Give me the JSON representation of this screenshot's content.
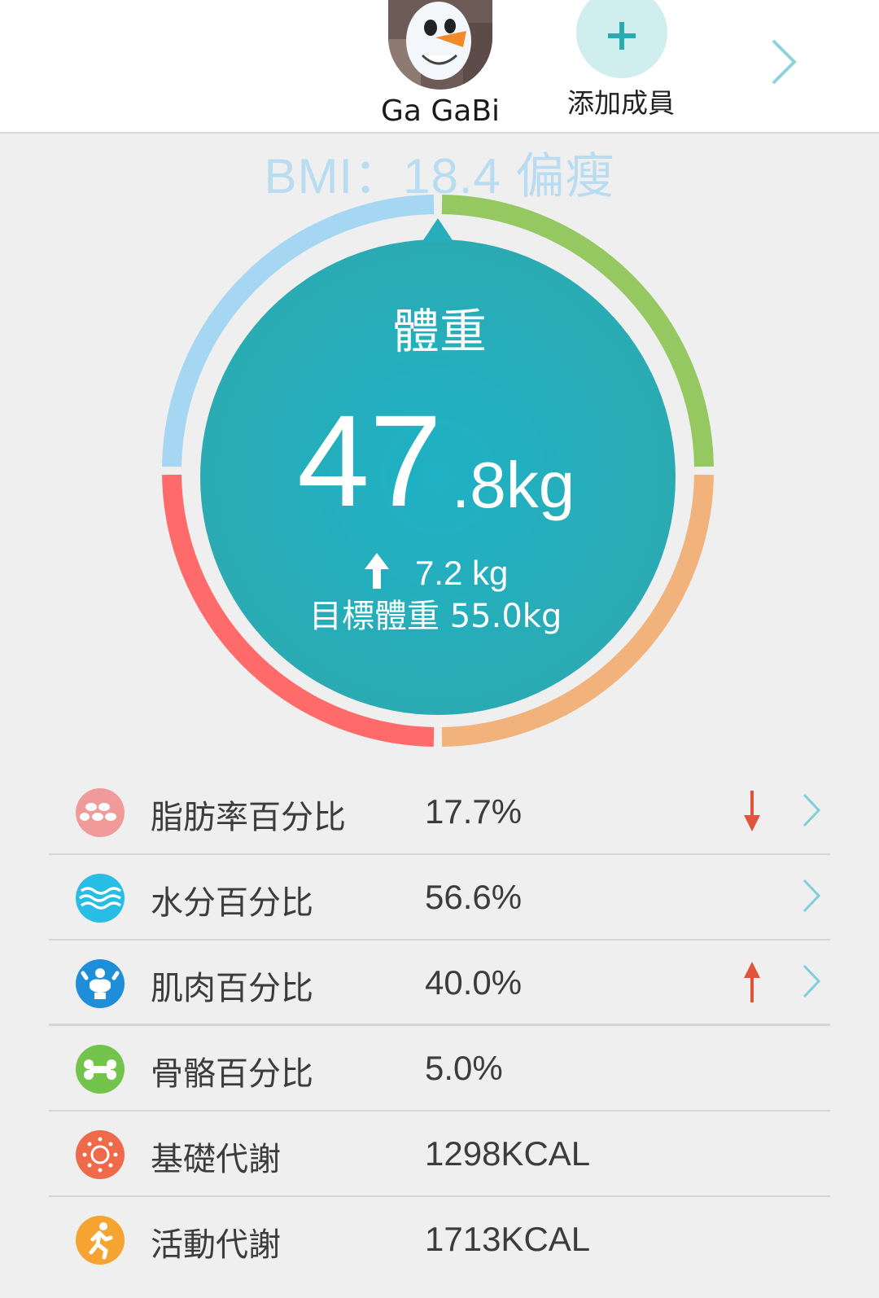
{
  "header": {
    "member_name": "Ga GaBi",
    "add_member_label": "添加成員"
  },
  "bmi": {
    "label": "BMI：18.4 偏瘦",
    "value": 18.4,
    "status": "偏瘦"
  },
  "gauge": {
    "title": "體重",
    "weight_integer": "47",
    "weight_decimal": ".8kg",
    "delta": "7.2 kg",
    "delta_direction": "up",
    "target": "目標體重 55.0kg",
    "segment_colors": [
      "#a5d6f2",
      "#95c860",
      "#f1b27c",
      "#ff6a6a"
    ],
    "center_color": "#23b0be"
  },
  "metrics": [
    {
      "label": "脂肪率百分比",
      "value": "17.7%",
      "trend": "down",
      "icon": "fat-icon",
      "icon_color": "#f19a9a",
      "has_chevron": true
    },
    {
      "label": "水分百分比",
      "value": "56.6%",
      "trend": "",
      "icon": "water-icon",
      "icon_color": "#27bde4",
      "has_chevron": true
    },
    {
      "label": "肌肉百分比",
      "value": "40.0%",
      "trend": "up",
      "icon": "muscle-icon",
      "icon_color": "#1f8ed8",
      "has_chevron": true
    },
    {
      "label": "骨骼百分比",
      "value": "5.0%",
      "trend": "",
      "icon": "bone-icon",
      "icon_color": "#73c44c",
      "has_chevron": false
    },
    {
      "label": "基礎代謝",
      "value": "1298KCAL",
      "trend": "",
      "icon": "metabolism-icon",
      "icon_color": "#ee6a4b",
      "has_chevron": false
    },
    {
      "label": "活動代謝",
      "value": "1713KCAL",
      "trend": "",
      "icon": "activity-icon",
      "icon_color": "#f5a331",
      "has_chevron": false
    }
  ],
  "colors": {
    "accent": "#2aabb3",
    "trend_arrow": "#e0533c",
    "chevron": "#7fd0d7"
  }
}
